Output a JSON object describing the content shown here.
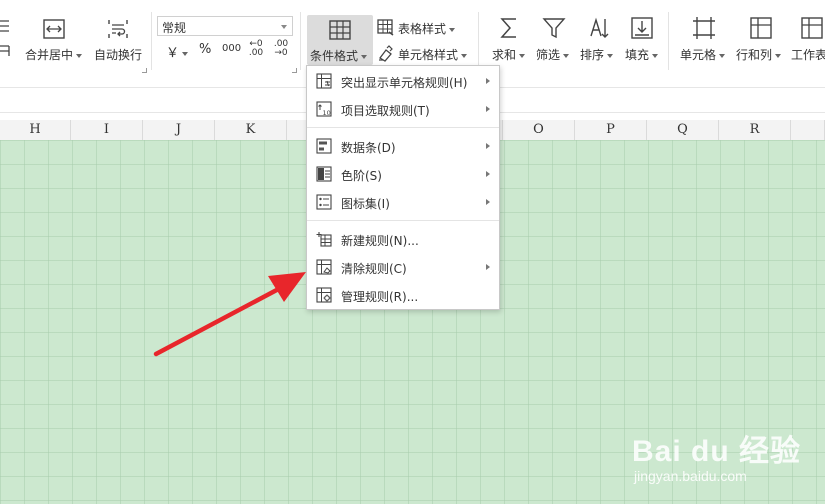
{
  "ribbon": {
    "merge_center_label": "合并居中",
    "wrap_text_label": "自动换行",
    "number_format_value": "常规",
    "currency_symbol": "￥",
    "percent_symbol": "%",
    "thousands_symbol": "000",
    "increase_decimal_symbol": "←0 .00",
    "decrease_decimal_symbol": ".00 →0",
    "conditional_format_label": "条件格式",
    "table_style_label": "表格样式",
    "cell_style_label": "单元格样式",
    "sum_label": "求和",
    "filter_label": "筛选",
    "sort_label": "排序",
    "fill_label": "填充",
    "cell_label": "单元格",
    "row_col_label": "行和列",
    "worksheet_label": "工作表"
  },
  "columns": [
    "H",
    "I",
    "J",
    "K",
    "O",
    "P",
    "Q",
    "R"
  ],
  "cf_menu": {
    "items": [
      {
        "label": "突出显示单元格规则(H)",
        "submenu": true
      },
      {
        "label": "项目选取规则(T)",
        "submenu": true
      },
      {
        "label": "数据条(D)",
        "submenu": true
      },
      {
        "label": "色阶(S)",
        "submenu": true
      },
      {
        "label": "图标集(I)",
        "submenu": true
      },
      {
        "label": "新建规则(N)...",
        "submenu": false
      },
      {
        "label": "清除规则(C)",
        "submenu": true
      },
      {
        "label": "管理规则(R)...",
        "submenu": false
      }
    ]
  },
  "watermark": {
    "logo_text": "Bai du 经验",
    "url_text": "jingyan.baidu.com"
  },
  "colors": {
    "grid_bg": "#cce8cf",
    "arrow": "#e8262b",
    "highlight": "#dcdcdc"
  }
}
